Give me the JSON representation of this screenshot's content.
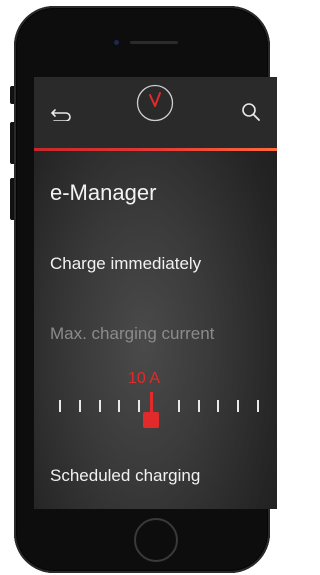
{
  "app": {
    "title": "e-Manager"
  },
  "toolbar": {
    "back_icon": "back-arrow-icon",
    "center_icon": "clock-icon",
    "search_icon": "search-icon"
  },
  "menu": {
    "items": [
      {
        "label": "Charge immediately"
      },
      {
        "label": "Max. charging current"
      },
      {
        "label": "Scheduled charging"
      }
    ]
  },
  "slider": {
    "value_label": "10 A",
    "tick_count": 11,
    "selected_index": 5
  },
  "colors": {
    "accent": "#e32a2a",
    "accent_gradient_end": "#ff6a3d",
    "text": "#f1f1f1",
    "disabled_text": "#8b8b8b"
  }
}
